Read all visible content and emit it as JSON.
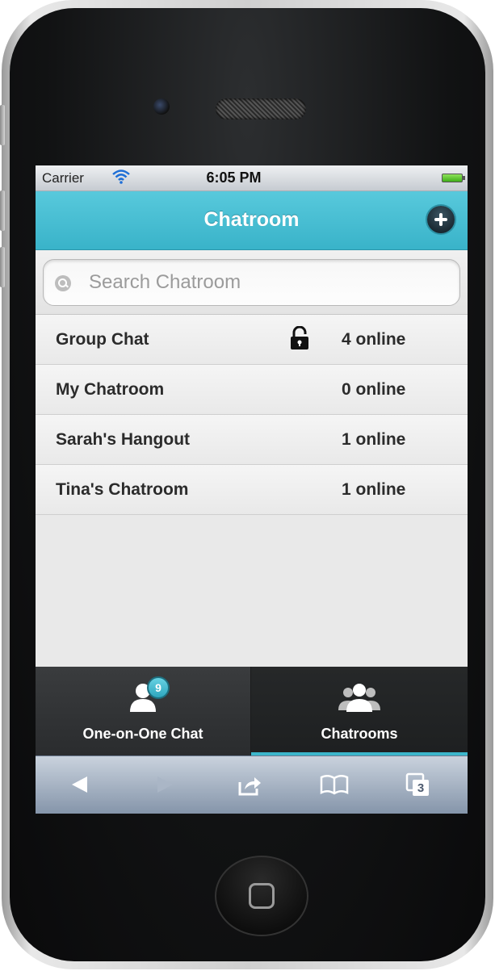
{
  "status_bar": {
    "carrier": "Carrier",
    "time": "6:05 PM"
  },
  "header": {
    "title": "Chatroom",
    "add_icon": "plus-circle-icon"
  },
  "search": {
    "placeholder": "Search Chatroom",
    "icon": "search-icon"
  },
  "chatrooms": [
    {
      "name": "Group Chat",
      "online": "4 online",
      "locked": true
    },
    {
      "name": "My Chatroom",
      "online": "0 online",
      "locked": false
    },
    {
      "name": "Sarah's Hangout",
      "online": "1 online",
      "locked": false
    },
    {
      "name": "Tina's Chatroom",
      "online": "1 online",
      "locked": false
    }
  ],
  "tabs": [
    {
      "label": "One-on-One Chat",
      "badge": "9",
      "icon": "user-icon",
      "active": false
    },
    {
      "label": "Chatrooms",
      "icon": "group-icon",
      "active": true
    }
  ],
  "browser_toolbar": {
    "tabs_count": "3",
    "icons": [
      "back-arrow-icon",
      "forward-arrow-icon",
      "share-icon",
      "bookmarks-icon",
      "pages-icon"
    ]
  },
  "colors": {
    "accent": "#3bb6cb",
    "header_bg": "#4bbfd3",
    "tab_bar_bg": "#2a2c2e"
  }
}
